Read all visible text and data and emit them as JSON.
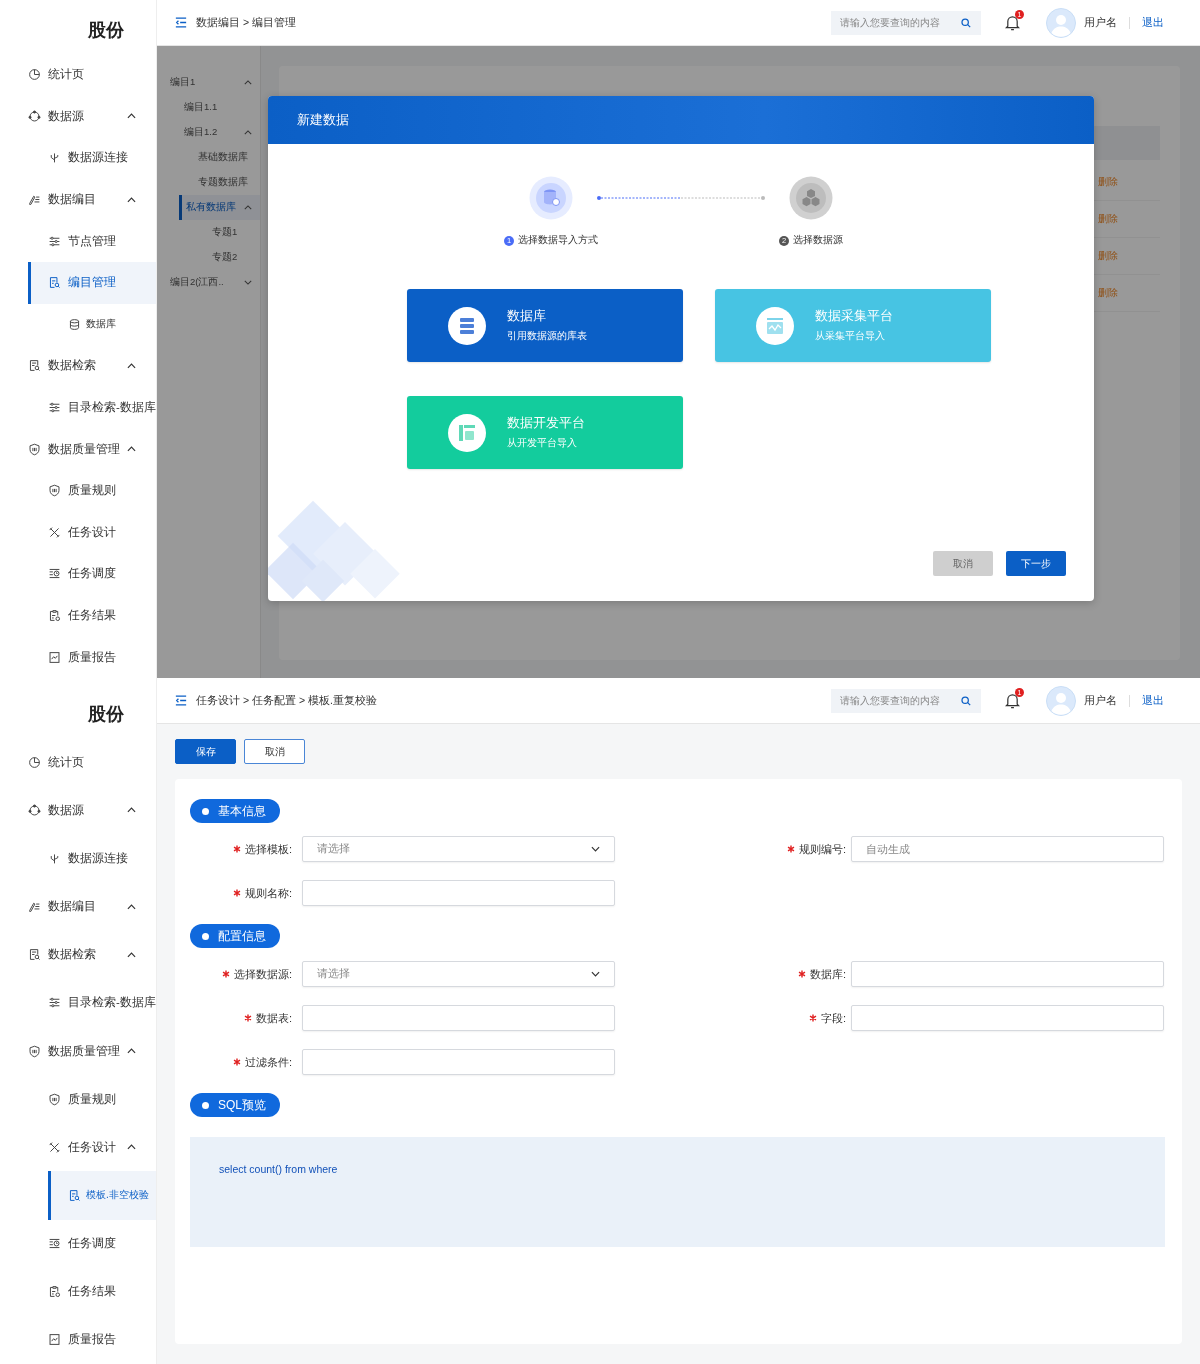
{
  "screens": [
    {
      "kind": "dialog",
      "logo": "股份",
      "sidebar": [
        {
          "label": "统计页",
          "selected": false
        },
        {
          "label": "数据源",
          "selected": false,
          "expanded": true,
          "children": [
            {
              "label": "数据源连接",
              "selected": false
            }
          ]
        },
        {
          "label": "数据编目",
          "selected": false,
          "expanded": true,
          "children": [
            {
              "label": "节点管理",
              "selected": false
            },
            {
              "label": "编目管理",
              "selected": true,
              "children": [
                {
                  "label": "数据库",
                  "selected": false
                }
              ]
            }
          ]
        },
        {
          "label": "数据检索",
          "selected": false,
          "expanded": true,
          "children": [
            {
              "label": "目录检索-数据库",
              "selected": false
            }
          ]
        },
        {
          "label": "数据质量管理",
          "selected": false,
          "expanded": true,
          "children": [
            {
              "label": "质量规则",
              "selected": false
            },
            {
              "label": "任务设计",
              "selected": false
            },
            {
              "label": "任务调度",
              "selected": false
            },
            {
              "label": "任务结果",
              "selected": false
            },
            {
              "label": "质量报告",
              "selected": false
            }
          ]
        }
      ],
      "header": {
        "breadcrumb": "数据编目 > 编目管理",
        "search_placeholder": "请输入您要查询的内容",
        "notification_count": "1",
        "username": "用户名",
        "logout": "退出"
      },
      "tree": [
        {
          "label": "编目1",
          "selected": false,
          "expanded": true,
          "children": [
            {
              "label": "编目1.1",
              "selected": false
            },
            {
              "label": "编目1.2",
              "selected": false,
              "expanded": true,
              "children": [
                {
                  "label": "基础数据库",
                  "selected": false
                },
                {
                  "label": "专题数据库",
                  "selected": false
                },
                {
                  "label": "私有数据库",
                  "selected": true,
                  "expanded": true,
                  "children": [
                    {
                      "label": "专题1",
                      "selected": false
                    },
                    {
                      "label": "专题2",
                      "selected": false
                    }
                  ]
                }
              ]
            }
          ]
        },
        {
          "label": "编目2(江西..",
          "selected": false,
          "expanded": false
        }
      ],
      "row_actions": [
        "删除",
        "删除",
        "删除",
        "删除"
      ],
      "modal": {
        "title": "新建数据",
        "steps": [
          {
            "num": "1",
            "label": "选择数据导入方式",
            "selected": true
          },
          {
            "num": "2",
            "label": "选择数据源",
            "selected": false
          }
        ],
        "options": [
          {
            "title": "数据库",
            "desc": "引用数据源的库表",
            "color": "#0b5fc6"
          },
          {
            "title": "数据采集平台",
            "desc": "从采集平台导入",
            "color": "#47c4e3"
          },
          {
            "title": "数据开发平台",
            "desc": "从开发平台导入",
            "color": "#13cc9d"
          }
        ],
        "buttons": [
          {
            "label": "取消",
            "kind": "secondary"
          },
          {
            "label": "下一步",
            "kind": "primary"
          }
        ]
      }
    },
    {
      "kind": "form",
      "logo": "股份",
      "sidebar": [
        {
          "label": "统计页",
          "selected": false
        },
        {
          "label": "数据源",
          "selected": false,
          "expanded": true,
          "children": [
            {
              "label": "数据源连接",
              "selected": false
            }
          ]
        },
        {
          "label": "数据编目",
          "selected": false,
          "expanded": true
        },
        {
          "label": "数据检索",
          "selected": false,
          "expanded": true,
          "children": [
            {
              "label": "目录检索-数据库",
              "selected": false
            }
          ]
        },
        {
          "label": "数据质量管理",
          "selected": false,
          "expanded": true,
          "children": [
            {
              "label": "质量规则",
              "selected": false
            },
            {
              "label": "任务设计",
              "selected": false,
              "expanded": true,
              "children": [
                {
                  "label": "模板.非空校验",
                  "selected": true
                }
              ]
            },
            {
              "label": "任务调度",
              "selected": false
            },
            {
              "label": "任务结果",
              "selected": false
            },
            {
              "label": "质量报告",
              "selected": false
            }
          ]
        }
      ],
      "header": {
        "breadcrumb": "任务设计 > 任务配置 > 模板.重复校验",
        "search_placeholder": "请输入您要查询的内容",
        "notification_count": "1",
        "username": "用户名",
        "logout": "退出"
      },
      "actions": [
        {
          "label": "保存",
          "kind": "primary"
        },
        {
          "label": "取消",
          "kind": "outline"
        }
      ],
      "sections": [
        {
          "title": "基本信息",
          "rows": [
            [
              {
                "label": "选择模板:",
                "required": true,
                "kind": "select",
                "placeholder": "请选择"
              },
              {
                "label": "规则编号:",
                "required": true,
                "kind": "input",
                "placeholder": "自动生成"
              }
            ],
            [
              {
                "label": "规则名称:",
                "required": true,
                "kind": "input"
              }
            ]
          ]
        },
        {
          "title": "配置信息",
          "rows": [
            [
              {
                "label": "选择数据源:",
                "required": true,
                "kind": "select",
                "placeholder": "请选择"
              },
              {
                "label": "数据库:",
                "required": true,
                "kind": "input"
              }
            ],
            [
              {
                "label": "数据表:",
                "required": true,
                "kind": "input"
              },
              {
                "label": "字段:",
                "required": true,
                "kind": "input"
              }
            ],
            [
              {
                "label": "过滤条件:",
                "required": true,
                "kind": "input"
              }
            ]
          ]
        },
        {
          "title": "SQL预览",
          "code": "select count() from where"
        }
      ]
    }
  ]
}
